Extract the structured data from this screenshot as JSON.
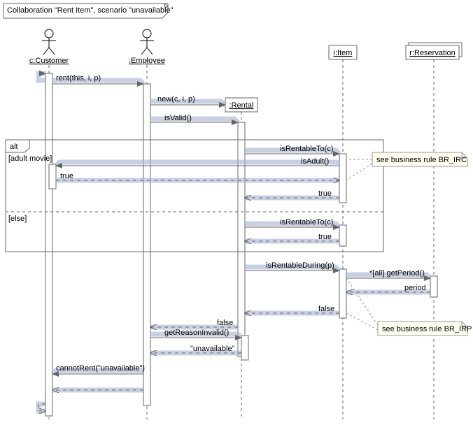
{
  "frame_title": "Collaboration \"Rent Item\", scenario \"unavailable\"",
  "participants": {
    "customer": "c:Customer",
    "employee": ":Employee",
    "rental": ":Rental",
    "item": "i:Item",
    "reservation": "r:Reservation"
  },
  "alt": {
    "label": "alt",
    "guard1": "[adult movie]",
    "guard2": "[else]"
  },
  "messages": {
    "rent": "rent(this, i, p)",
    "new": "new(c, i, p)",
    "isValid": "isValid()",
    "isRentableTo1": "isRentableTo(c)",
    "isAdult": "isAdult()",
    "true1": "true",
    "true2": "true",
    "isRentableTo2": "isRentableTo(c)",
    "true3": "true",
    "isRentableDuring": "isRentableDuring(p)",
    "getPeriod": "*[all] getPeriod()",
    "period": "period",
    "false1": "false",
    "false2": "false",
    "getReasonInvalid": "getReasonInvalid()",
    "unavailable": "\"unavailable\"",
    "cannotRent": "cannotRent(\"unavailable\")"
  },
  "notes": {
    "br_irc": "see business rule BR_IRC",
    "br_irp": "see business rule BR_IRP"
  }
}
